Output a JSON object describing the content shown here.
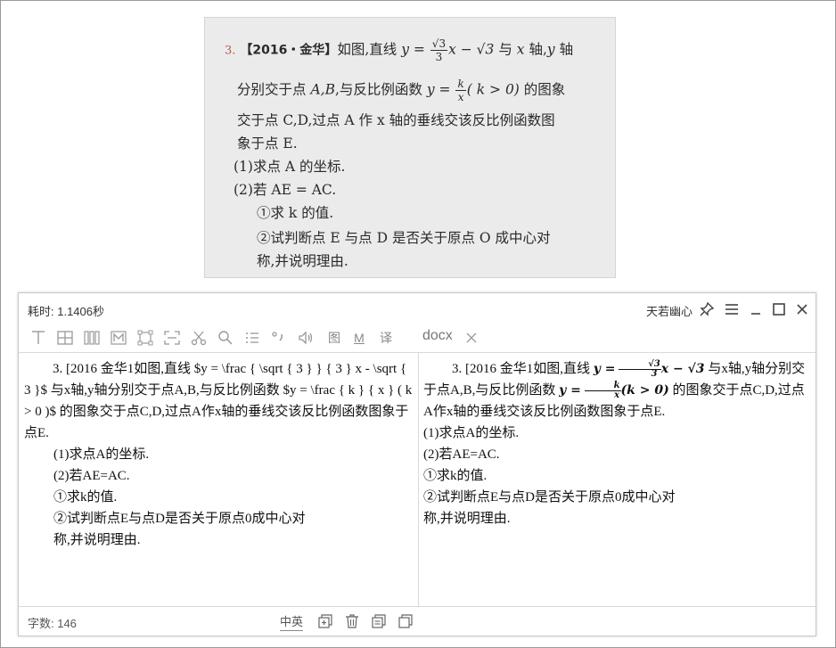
{
  "photo": {
    "q_number": "3.",
    "line1_a": "【2016・金华】",
    "line1_b": "如图,直线",
    "line1_c": "与",
    "line1_d": "轴,",
    "line1_e": "轴",
    "eq1_lhs": "y =",
    "eq1_num": "√3",
    "eq1_den": "3",
    "eq1_rhs": "x − √3",
    "var_x": "x",
    "var_y": "y",
    "line2_a": "分别交于点",
    "line2_pts": "A,B",
    "line2_b": ",与反比例函数",
    "eq2_lhs": "y =",
    "eq2_num": "k",
    "eq2_den": "x",
    "eq2_cond": "( k > 0)",
    "line2_c": "的图象",
    "line3": "交于点 C,D,过点 A 作 x 轴的垂线交该反比例函数图",
    "line4": "象于点 E.",
    "line5": "(1)求点 A 的坐标.",
    "line6": "(2)若 AE = AC.",
    "line7": "①求 k 的值.",
    "line8": "②试判断点 E 与点 D 是否关于原点 O 成中心对",
    "line9": "称,并说明理由."
  },
  "window": {
    "elapsed": "耗时:  1.1406秒",
    "brand": "天若幽心",
    "title_icons": [
      "pin-icon",
      "menu-icon",
      "minimize-icon",
      "maximize-icon",
      "close-icon"
    ],
    "toolbar": {
      "tool_tu": "图",
      "tool_m": "M",
      "tool_yi": "译",
      "docx": "docx"
    },
    "left": {
      "p1": "3. [2016 金华1如图,直线 $y = \\frac { \\sqrt { 3 } } { 3 } x - \\sqrt { 3 }$ 与x轴,y轴分别交于点A,B,与反比例函数 $y = \\frac { k } { x } ( k > 0 )$ 的图象交于点C,D,过点A作x轴的垂线交该反比例函数图象于点E.",
      "p2": "(1)求点A的坐标.",
      "p3": "(2)若AE=AC.",
      "p4": "①求k的值.",
      "p5": "②试判断点E与点D是否关于原点0成中心对",
      "p6": "称,并说明理由."
    },
    "right": {
      "p1_a": "3. [2016 金华1如图,直线",
      "m1_lhs": "y =",
      "m1_num": "√3",
      "m1_den": "3",
      "m1_rhs": "x − √3",
      "p1_b": "与x轴,y轴分别交于点A,B,与反比例函数",
      "m2_lhs": "y =",
      "m2_num": "k",
      "m2_den": "x",
      "m2_rhs": "(k > 0)",
      "p1_c": "的图象交于点C,D,过点A作x轴的垂线交该反比例函数图象于点E.",
      "p2": "(1)求点A的坐标.",
      "p3": "(2)若AE=AC.",
      "p4": "①求k的值.",
      "p5": "②试判断点E与点D是否关于原点0成中心对",
      "p6": "称,并说明理由."
    },
    "status": {
      "word_count": "字数:  146",
      "lang": "中英"
    }
  }
}
